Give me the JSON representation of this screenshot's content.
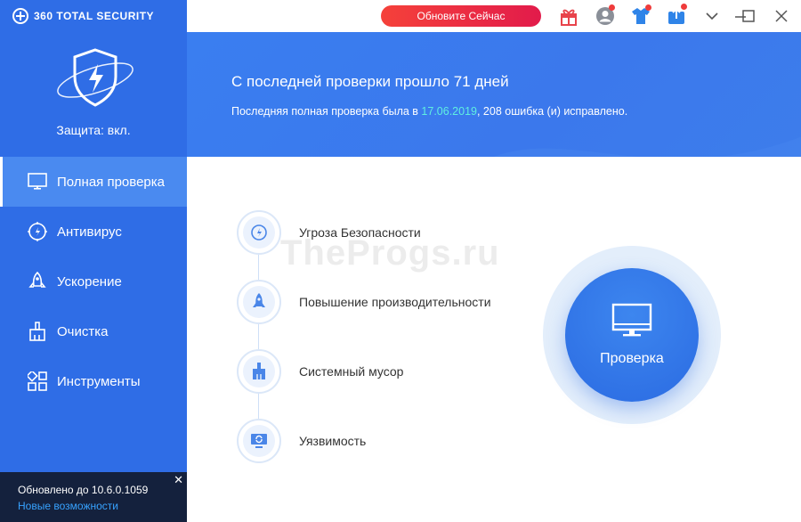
{
  "app": {
    "brand": "360 TOTAL SECURITY",
    "protection_status": "Защита: вкл."
  },
  "titlebar": {
    "upgrade_button": "Обновите Сейчас"
  },
  "sidebar": {
    "items": [
      {
        "label": "Полная проверка",
        "icon": "monitor-icon",
        "active": true
      },
      {
        "label": "Антивирус",
        "icon": "antivirus-icon",
        "active": false
      },
      {
        "label": "Ускорение",
        "icon": "rocket-icon",
        "active": false
      },
      {
        "label": "Очистка",
        "icon": "broom-icon",
        "active": false
      },
      {
        "label": "Инструменты",
        "icon": "tools-icon",
        "active": false
      }
    ],
    "update": {
      "text": "Обновлено до 10.6.0.1059",
      "link": "Новые возможности"
    }
  },
  "banner": {
    "title": "С последней проверки прошло 71 дней",
    "sub_prefix": "Последняя полная проверка была в ",
    "sub_date": "17.06.2019",
    "sub_suffix": ", 208 ошибка (и) исправлено."
  },
  "main": {
    "steps": [
      {
        "label": "Угроза Безопасности",
        "icon": "threat-icon"
      },
      {
        "label": "Повышение производительности",
        "icon": "rocket-icon"
      },
      {
        "label": "Системный мусор",
        "icon": "broom-icon"
      },
      {
        "label": "Уязвимость",
        "icon": "vulnerability-icon"
      }
    ],
    "scan_button": "Проверка",
    "watermark": "TheProgs.ru"
  },
  "colors": {
    "sidebar": "#2f6de6",
    "active_item": "#4a8af0",
    "update_bar": "#14213d",
    "accent_date": "#5ff0e0",
    "upgrade_button": "#e92745"
  }
}
